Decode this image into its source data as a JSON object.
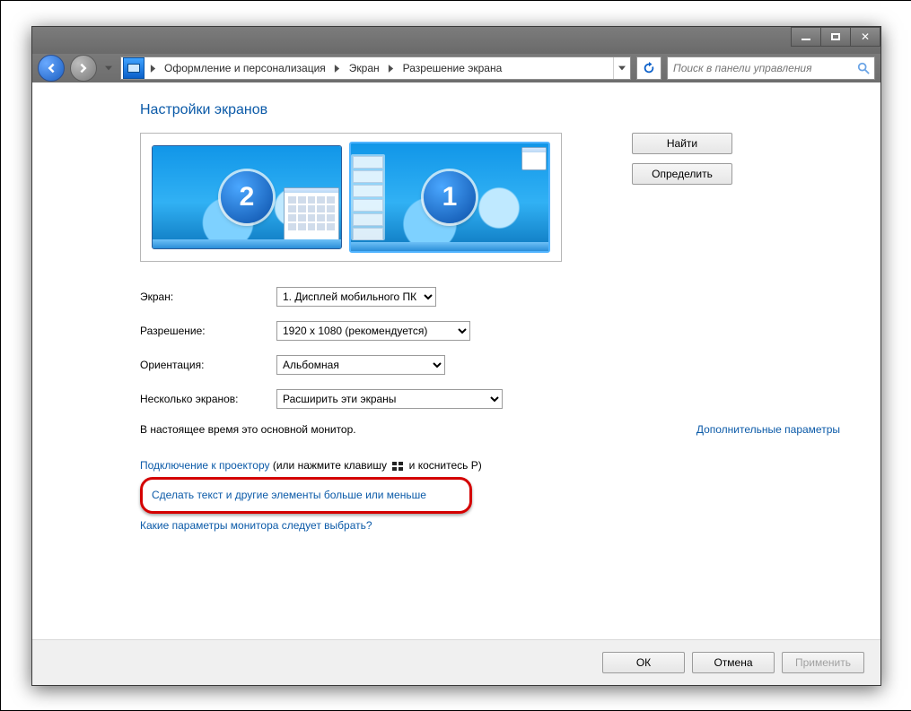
{
  "titlebar": {
    "min": "",
    "max": "",
    "close": ""
  },
  "nav": {
    "crumbs": [
      "Оформление и персонализация",
      "Экран",
      "Разрешение экрана"
    ],
    "search_placeholder": "Поиск в панели управления"
  },
  "heading": "Настройки экранов",
  "monitors": {
    "primary": "1",
    "secondary": "2"
  },
  "buttons": {
    "find": "Найти",
    "identify": "Определить"
  },
  "form": {
    "screen": {
      "label": "Экран:",
      "value": "1. Дисплей мобильного ПК"
    },
    "resolution": {
      "label": "Разрешение:",
      "value": "1920 x 1080 (рекомендуется)"
    },
    "orientation": {
      "label": "Ориентация:",
      "value": "Альбомная"
    },
    "multi": {
      "label": "Несколько экранов:",
      "value": "Расширить эти экраны"
    }
  },
  "primary_text": "В настоящее время это основной монитор.",
  "advanced_link": "Дополнительные параметры",
  "links": {
    "projector_pre": "Подключение к проектору",
    "projector_post1": " (или нажмите клавишу ",
    "projector_post2": " и коснитесь P)",
    "resize": "Сделать текст и другие элементы больше или меньше",
    "which": "Какие параметры монитора следует выбрать?"
  },
  "footer": {
    "ok": "ОК",
    "cancel": "Отмена",
    "apply": "Применить"
  }
}
